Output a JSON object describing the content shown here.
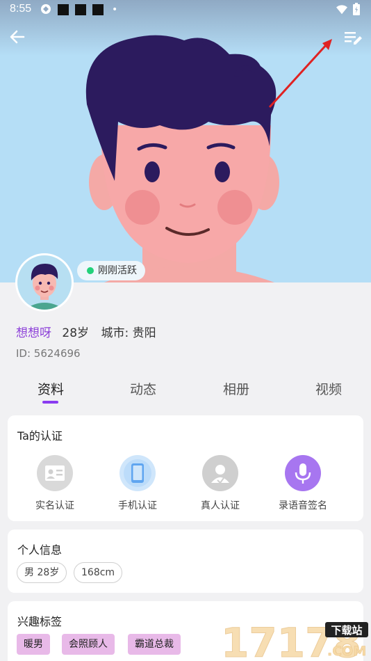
{
  "status_bar": {
    "time": "8:55"
  },
  "profile": {
    "active_status": "刚刚活跃",
    "nickname": "想想呀",
    "age": "28岁",
    "city_label": "城市:",
    "city": "贵阳",
    "id_text": "ID: 5624696"
  },
  "tabs": [
    "资料",
    "动态",
    "相册",
    "视频"
  ],
  "certification": {
    "title": "Ta的认证",
    "items": [
      {
        "label": "实名认证",
        "icon": "id-card-icon",
        "color": "#d9d9d9"
      },
      {
        "label": "手机认证",
        "icon": "phone-icon",
        "color": "#cfe6fb"
      },
      {
        "label": "真人认证",
        "icon": "person-icon",
        "color": "#cfcfcf"
      },
      {
        "label": "录语音签名",
        "icon": "microphone-icon",
        "color": "#a776f0"
      }
    ]
  },
  "personal_info": {
    "title": "个人信息",
    "chips": [
      "男 28岁",
      "168cm"
    ]
  },
  "interests": {
    "title": "兴趣标签",
    "tags": [
      "暖男",
      "会照顾人",
      "霸道总裁"
    ]
  },
  "watermark": {
    "numbers": "17178",
    "domain": ".COM",
    "label": "下载站"
  },
  "colors": {
    "accent": "#8a3cf0",
    "nickname": "#8c3fd8",
    "online": "#22d17a",
    "tag_bg": "#e8b9e8"
  }
}
